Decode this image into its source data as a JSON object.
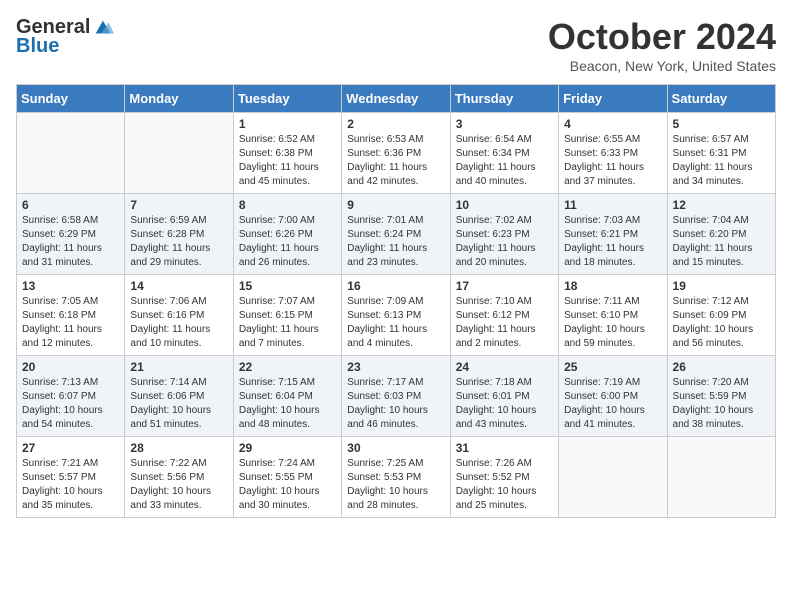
{
  "logo": {
    "general": "General",
    "blue": "Blue"
  },
  "title": "October 2024",
  "location": "Beacon, New York, United States",
  "days_of_week": [
    "Sunday",
    "Monday",
    "Tuesday",
    "Wednesday",
    "Thursday",
    "Friday",
    "Saturday"
  ],
  "weeks": [
    [
      {
        "day": "",
        "info": ""
      },
      {
        "day": "",
        "info": ""
      },
      {
        "day": "1",
        "info": "Sunrise: 6:52 AM\nSunset: 6:38 PM\nDaylight: 11 hours and 45 minutes."
      },
      {
        "day": "2",
        "info": "Sunrise: 6:53 AM\nSunset: 6:36 PM\nDaylight: 11 hours and 42 minutes."
      },
      {
        "day": "3",
        "info": "Sunrise: 6:54 AM\nSunset: 6:34 PM\nDaylight: 11 hours and 40 minutes."
      },
      {
        "day": "4",
        "info": "Sunrise: 6:55 AM\nSunset: 6:33 PM\nDaylight: 11 hours and 37 minutes."
      },
      {
        "day": "5",
        "info": "Sunrise: 6:57 AM\nSunset: 6:31 PM\nDaylight: 11 hours and 34 minutes."
      }
    ],
    [
      {
        "day": "6",
        "info": "Sunrise: 6:58 AM\nSunset: 6:29 PM\nDaylight: 11 hours and 31 minutes."
      },
      {
        "day": "7",
        "info": "Sunrise: 6:59 AM\nSunset: 6:28 PM\nDaylight: 11 hours and 29 minutes."
      },
      {
        "day": "8",
        "info": "Sunrise: 7:00 AM\nSunset: 6:26 PM\nDaylight: 11 hours and 26 minutes."
      },
      {
        "day": "9",
        "info": "Sunrise: 7:01 AM\nSunset: 6:24 PM\nDaylight: 11 hours and 23 minutes."
      },
      {
        "day": "10",
        "info": "Sunrise: 7:02 AM\nSunset: 6:23 PM\nDaylight: 11 hours and 20 minutes."
      },
      {
        "day": "11",
        "info": "Sunrise: 7:03 AM\nSunset: 6:21 PM\nDaylight: 11 hours and 18 minutes."
      },
      {
        "day": "12",
        "info": "Sunrise: 7:04 AM\nSunset: 6:20 PM\nDaylight: 11 hours and 15 minutes."
      }
    ],
    [
      {
        "day": "13",
        "info": "Sunrise: 7:05 AM\nSunset: 6:18 PM\nDaylight: 11 hours and 12 minutes."
      },
      {
        "day": "14",
        "info": "Sunrise: 7:06 AM\nSunset: 6:16 PM\nDaylight: 11 hours and 10 minutes."
      },
      {
        "day": "15",
        "info": "Sunrise: 7:07 AM\nSunset: 6:15 PM\nDaylight: 11 hours and 7 minutes."
      },
      {
        "day": "16",
        "info": "Sunrise: 7:09 AM\nSunset: 6:13 PM\nDaylight: 11 hours and 4 minutes."
      },
      {
        "day": "17",
        "info": "Sunrise: 7:10 AM\nSunset: 6:12 PM\nDaylight: 11 hours and 2 minutes."
      },
      {
        "day": "18",
        "info": "Sunrise: 7:11 AM\nSunset: 6:10 PM\nDaylight: 10 hours and 59 minutes."
      },
      {
        "day": "19",
        "info": "Sunrise: 7:12 AM\nSunset: 6:09 PM\nDaylight: 10 hours and 56 minutes."
      }
    ],
    [
      {
        "day": "20",
        "info": "Sunrise: 7:13 AM\nSunset: 6:07 PM\nDaylight: 10 hours and 54 minutes."
      },
      {
        "day": "21",
        "info": "Sunrise: 7:14 AM\nSunset: 6:06 PM\nDaylight: 10 hours and 51 minutes."
      },
      {
        "day": "22",
        "info": "Sunrise: 7:15 AM\nSunset: 6:04 PM\nDaylight: 10 hours and 48 minutes."
      },
      {
        "day": "23",
        "info": "Sunrise: 7:17 AM\nSunset: 6:03 PM\nDaylight: 10 hours and 46 minutes."
      },
      {
        "day": "24",
        "info": "Sunrise: 7:18 AM\nSunset: 6:01 PM\nDaylight: 10 hours and 43 minutes."
      },
      {
        "day": "25",
        "info": "Sunrise: 7:19 AM\nSunset: 6:00 PM\nDaylight: 10 hours and 41 minutes."
      },
      {
        "day": "26",
        "info": "Sunrise: 7:20 AM\nSunset: 5:59 PM\nDaylight: 10 hours and 38 minutes."
      }
    ],
    [
      {
        "day": "27",
        "info": "Sunrise: 7:21 AM\nSunset: 5:57 PM\nDaylight: 10 hours and 35 minutes."
      },
      {
        "day": "28",
        "info": "Sunrise: 7:22 AM\nSunset: 5:56 PM\nDaylight: 10 hours and 33 minutes."
      },
      {
        "day": "29",
        "info": "Sunrise: 7:24 AM\nSunset: 5:55 PM\nDaylight: 10 hours and 30 minutes."
      },
      {
        "day": "30",
        "info": "Sunrise: 7:25 AM\nSunset: 5:53 PM\nDaylight: 10 hours and 28 minutes."
      },
      {
        "day": "31",
        "info": "Sunrise: 7:26 AM\nSunset: 5:52 PM\nDaylight: 10 hours and 25 minutes."
      },
      {
        "day": "",
        "info": ""
      },
      {
        "day": "",
        "info": ""
      }
    ]
  ]
}
